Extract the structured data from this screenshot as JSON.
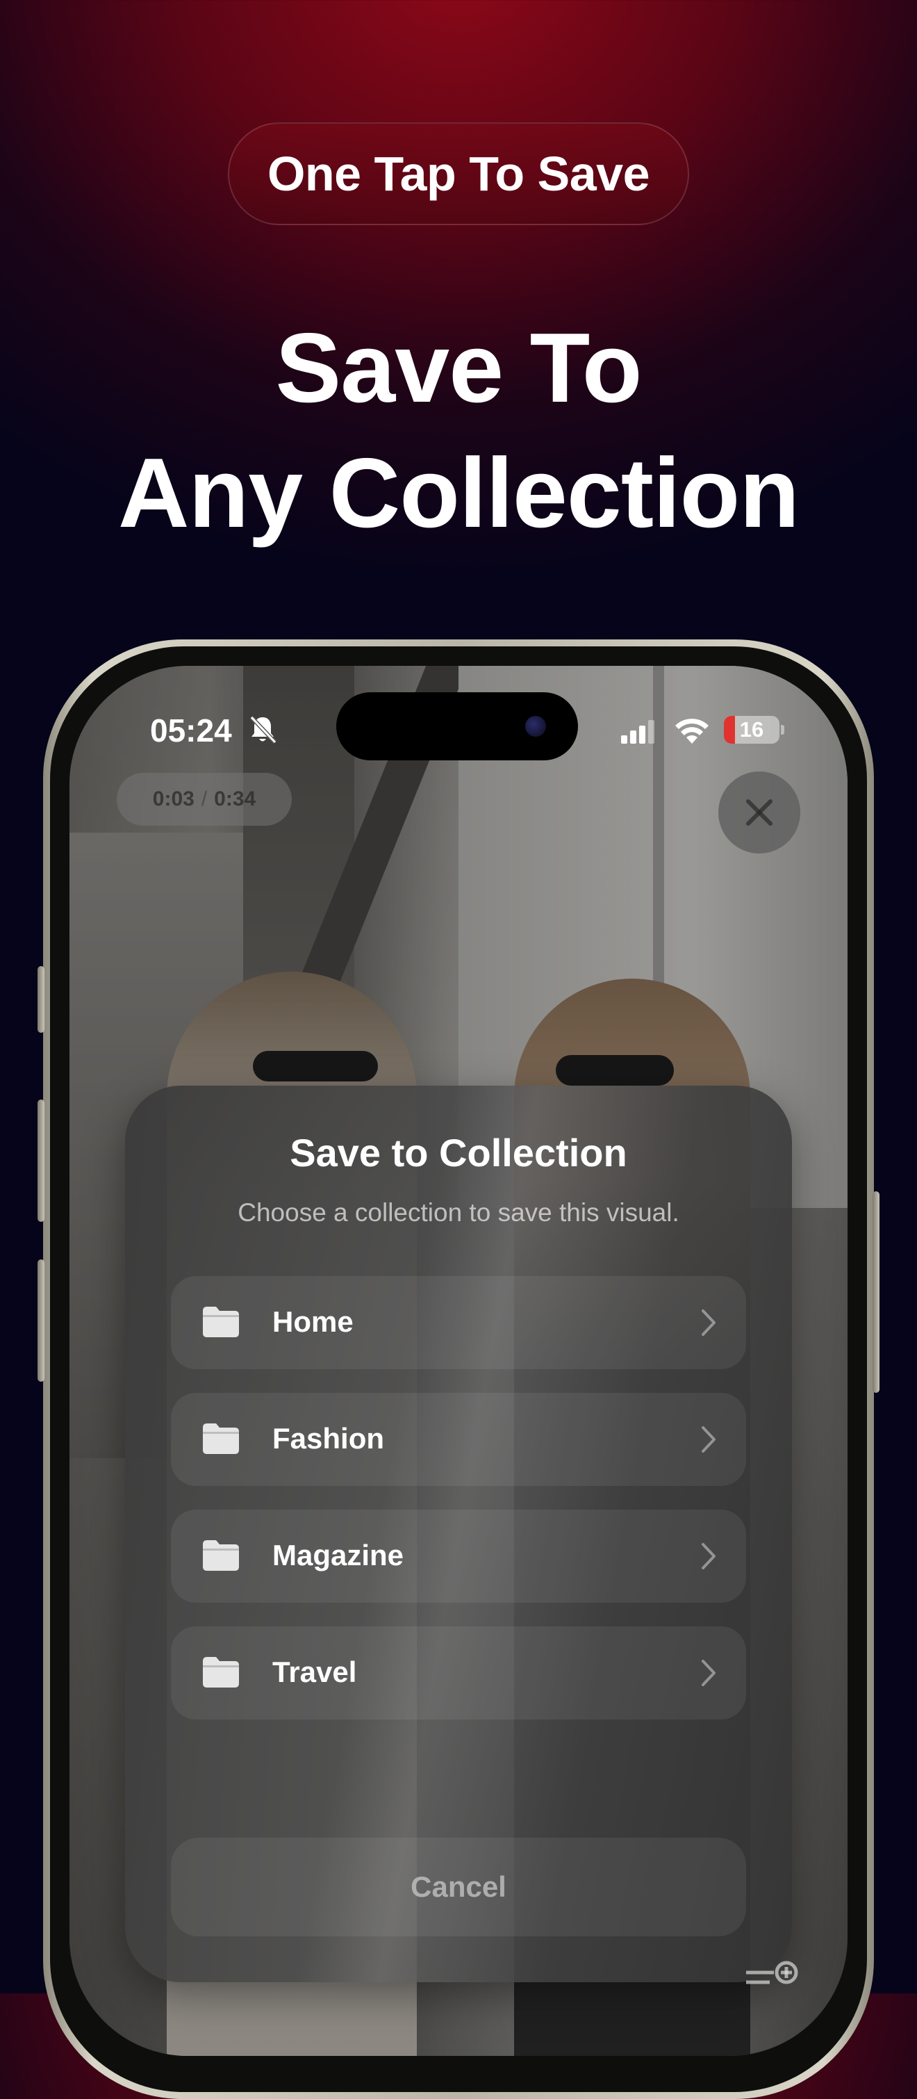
{
  "promo": {
    "pill_text": "One Tap To Save",
    "headline_line1": "Save To",
    "headline_line2": "Any Collection"
  },
  "status_bar": {
    "time": "05:24",
    "battery_level": "16",
    "battery_fraction": 0.2,
    "icons": [
      "bell-slash-icon",
      "signal-icon",
      "wifi-icon",
      "battery-icon"
    ]
  },
  "player": {
    "elapsed": "0:03",
    "separator": "/",
    "duration": "0:34"
  },
  "sheet": {
    "title": "Save to Collection",
    "subtitle": "Choose a collection to save this visual.",
    "collections": [
      {
        "label": "Home"
      },
      {
        "label": "Fashion"
      },
      {
        "label": "Magazine"
      },
      {
        "label": "Travel"
      }
    ],
    "cancel_label": "Cancel"
  },
  "colors": {
    "background_top": "#8c0818",
    "background_bottom": "#05041a",
    "battery_low": "#e0332f"
  }
}
